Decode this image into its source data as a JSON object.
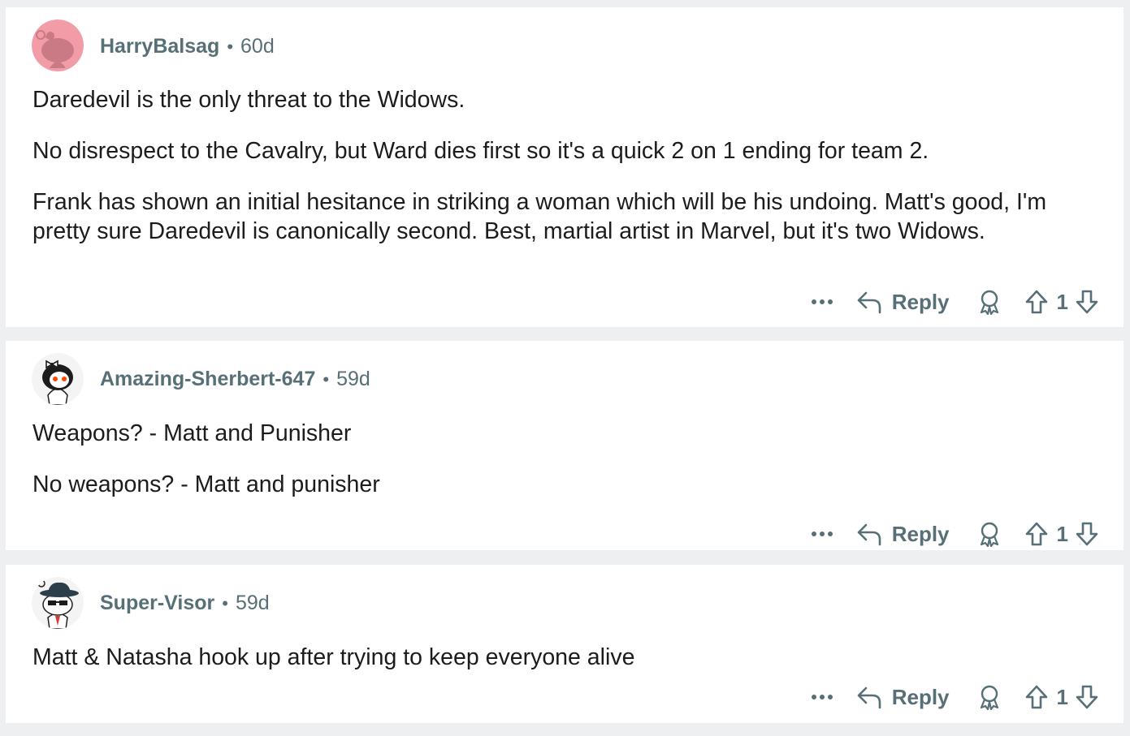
{
  "comments": [
    {
      "username": "HarryBalsag",
      "separator": "•",
      "age": "60d",
      "paragraphs": [
        "Daredevil is the only threat to the Widows.",
        "No disrespect to the Cavalry, but Ward dies first so it's a quick 2 on 1 ending for team 2.",
        "Frank has shown an initial hesitance in striking a woman which will be his undoing. Matt's good, I'm pretty sure Daredevil is canonically second. Best, martial artist in Marvel, but it's two Widows."
      ],
      "reply_label": "Reply",
      "score": "1",
      "avatar_color": "#f29ca8"
    },
    {
      "username": "Amazing-Sherbert-647",
      "separator": "•",
      "age": "59d",
      "paragraphs": [
        "Weapons? - Matt and Punisher",
        "No weapons? - Matt and punisher"
      ],
      "reply_label": "Reply",
      "score": "1",
      "avatar_color": "#f4f4f4"
    },
    {
      "username": "Super-Visor",
      "separator": "•",
      "age": "59d",
      "paragraphs": [
        "Matt & Natasha hook up after trying to keep everyone alive"
      ],
      "reply_label": "Reply",
      "score": "1",
      "avatar_color": "#f4f4f4"
    }
  ],
  "icons": {
    "more": "more-options-icon",
    "reply": "reply-arrow-icon",
    "award": "award-icon",
    "upvote": "upvote-arrow-icon",
    "downvote": "downvote-arrow-icon"
  },
  "colors": {
    "page_bg": "#edeff1",
    "card_bg": "#ffffff",
    "meta_text": "#576f76",
    "body_text": "#1c1c1c"
  }
}
